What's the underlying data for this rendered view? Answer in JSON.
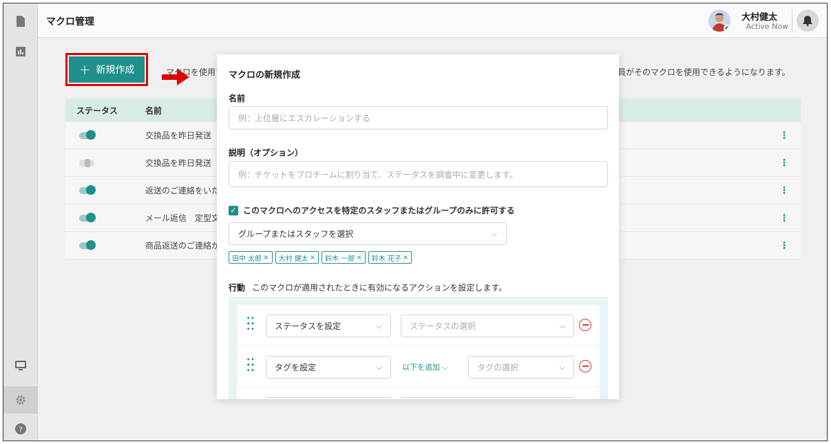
{
  "header": {
    "title": "マクロ管理",
    "user_name": "大村健太",
    "user_status": "Active Now"
  },
  "main": {
    "new_button_label": "新規作成",
    "hint_left": "マクロを使用す",
    "hint_right": "員がそのマクロを使用できるようになります。",
    "table": {
      "headers": [
        "ステータス",
        "名前"
      ],
      "rows": [
        {
          "name": "交換品を昨日発送",
          "enabled": true
        },
        {
          "name": "交換品を昨日発送",
          "enabled": false
        },
        {
          "name": "返送のご連絡をいた",
          "enabled": true
        },
        {
          "name": "メール返信　定型文",
          "enabled": true
        },
        {
          "name": "商品返送のご連絡か",
          "enabled": true
        }
      ]
    }
  },
  "modal": {
    "title": "マクロの新規作成",
    "name_label": "名前",
    "name_placeholder": "例：上位層にエスカレーションする",
    "desc_label": "説明（オプション）",
    "desc_placeholder": "例：チケットをプロチームに割り当て、ステータスを調査中に変更します。",
    "access_checkbox_label": "このマクロへのアクセスを特定のスタッフまたはグループのみに許可する",
    "access_checked": true,
    "group_select_value": "グループまたはスタッフを選択",
    "tags": [
      "田中 太郎",
      "大村 健太",
      "鈴木 一郎",
      "鈴木 花子"
    ],
    "action_title": "行動",
    "action_desc": "このマクロが適用されたときに有効になるアクションを設定します。",
    "actions": [
      {
        "type": "ステータスを設定",
        "value_placeholder": "ステータスの選択"
      },
      {
        "type": "タグを設定",
        "modifier": "以下を追加",
        "value_placeholder": "タグの選択"
      }
    ]
  },
  "colors": {
    "accent": "#1e8f8a",
    "highlight": "#e00000",
    "remove": "#d33333"
  }
}
